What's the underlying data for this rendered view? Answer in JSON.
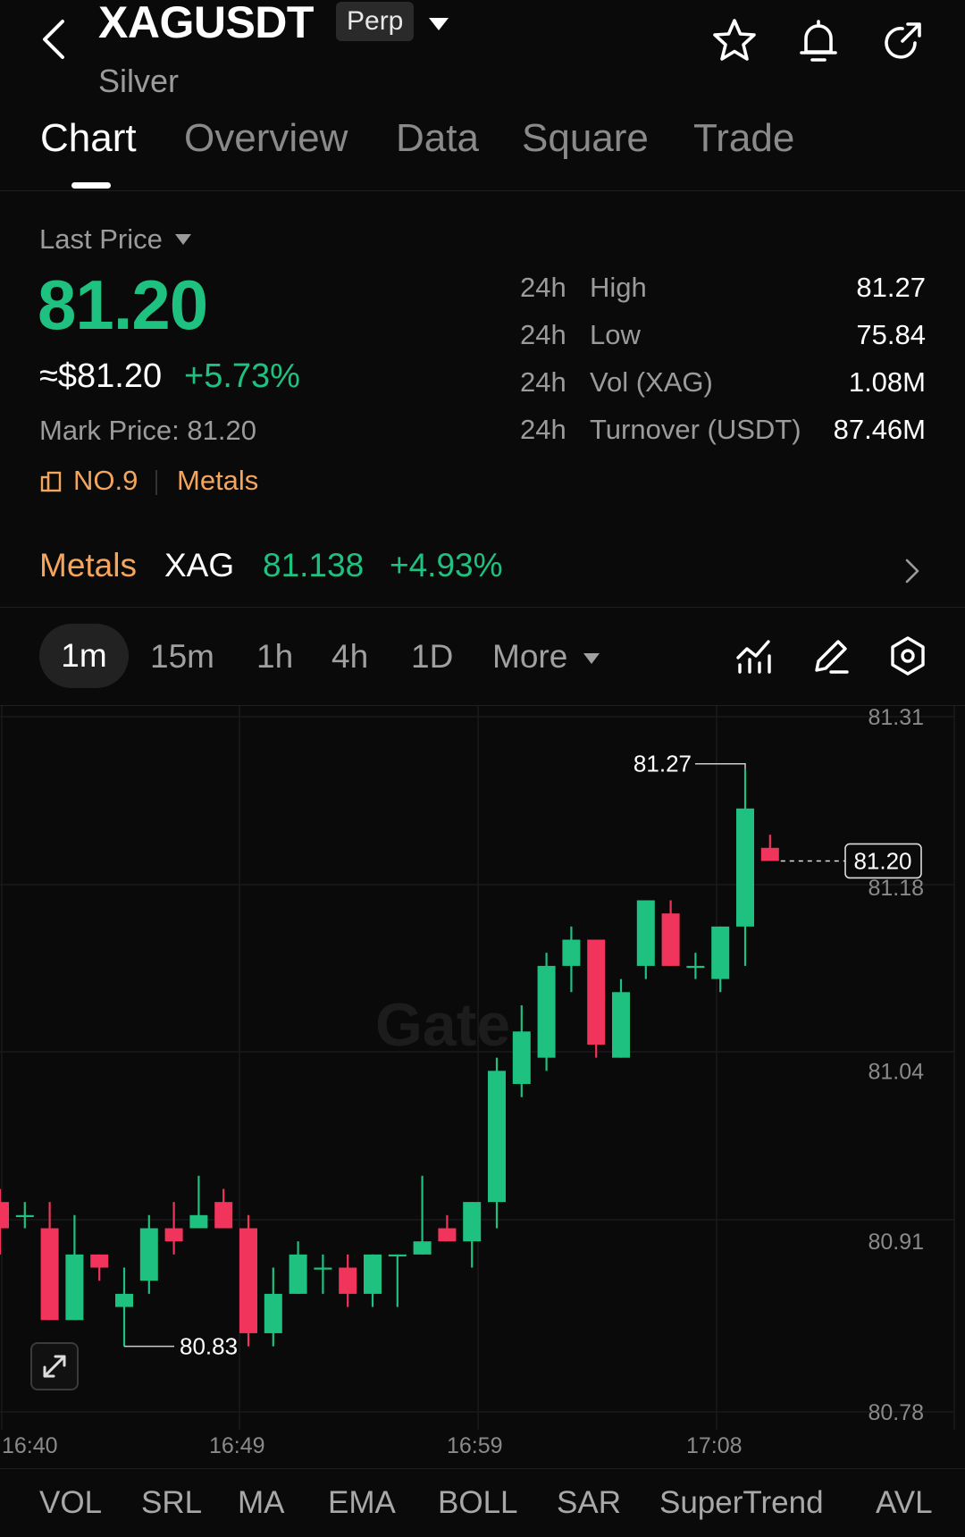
{
  "header": {
    "symbol": "XAGUSDT",
    "contract_type": "Perp",
    "name": "Silver",
    "icons": [
      "back-icon",
      "star-icon",
      "bell-icon",
      "share-icon"
    ]
  },
  "tabs": [
    {
      "label": "Chart",
      "active": true
    },
    {
      "label": "Overview",
      "active": false
    },
    {
      "label": "Data",
      "active": false
    },
    {
      "label": "Square",
      "active": false
    },
    {
      "label": "Trade",
      "active": false
    }
  ],
  "price": {
    "label": "Last Price",
    "last": "81.20",
    "usd": "≈$81.20",
    "change": "+5.73%",
    "mark": "Mark Price: 81.20",
    "rank": "NO.9",
    "category": "Metals"
  },
  "stats": [
    {
      "period": "24h",
      "name": "High",
      "value": "81.27"
    },
    {
      "period": "24h",
      "name": "Low",
      "value": "75.84"
    },
    {
      "period": "24h",
      "name": "Vol (XAG)",
      "value": "1.08M"
    },
    {
      "period": "24h",
      "name": "Turnover (USDT)",
      "value": "87.46M"
    }
  ],
  "index": {
    "category": "Metals",
    "symbol": "XAG",
    "price": "81.138",
    "change": "+4.93%"
  },
  "timeframes": [
    "1m",
    "15m",
    "1h",
    "4h",
    "1D",
    "More"
  ],
  "active_timeframe": "1m",
  "chart_labels": {
    "high_marker": "81.27",
    "low_marker": "80.83",
    "current_price": "81.20",
    "watermark": "Gate"
  },
  "chart_data": {
    "type": "candlestick",
    "interval": "1m",
    "y_ticks": [
      "81.31",
      "81.18",
      "81.04",
      "80.91",
      "80.78"
    ],
    "ylim": [
      80.78,
      81.31
    ],
    "x_ticks": [
      "16:40",
      "16:49",
      "16:59",
      "17:08"
    ],
    "candles": [
      {
        "o": 80.94,
        "c": 80.92,
        "h": 80.95,
        "l": 80.9
      },
      {
        "o": 80.93,
        "c": 80.93,
        "h": 80.94,
        "l": 80.92
      },
      {
        "o": 80.92,
        "c": 80.85,
        "h": 80.94,
        "l": 80.85
      },
      {
        "o": 80.85,
        "c": 80.9,
        "h": 80.93,
        "l": 80.85
      },
      {
        "o": 80.9,
        "c": 80.89,
        "h": 80.9,
        "l": 80.88
      },
      {
        "o": 80.86,
        "c": 80.87,
        "h": 80.89,
        "l": 80.83
      },
      {
        "o": 80.88,
        "c": 80.92,
        "h": 80.93,
        "l": 80.87
      },
      {
        "o": 80.92,
        "c": 80.91,
        "h": 80.94,
        "l": 80.9
      },
      {
        "o": 80.92,
        "c": 80.93,
        "h": 80.96,
        "l": 80.92
      },
      {
        "o": 80.94,
        "c": 80.92,
        "h": 80.95,
        "l": 80.92
      },
      {
        "o": 80.92,
        "c": 80.84,
        "h": 80.93,
        "l": 80.83
      },
      {
        "o": 80.84,
        "c": 80.87,
        "h": 80.89,
        "l": 80.83
      },
      {
        "o": 80.87,
        "c": 80.9,
        "h": 80.91,
        "l": 80.87
      },
      {
        "o": 80.89,
        "c": 80.89,
        "h": 80.9,
        "l": 80.87
      },
      {
        "o": 80.89,
        "c": 80.87,
        "h": 80.9,
        "l": 80.86
      },
      {
        "o": 80.87,
        "c": 80.9,
        "h": 80.9,
        "l": 80.86
      },
      {
        "o": 80.9,
        "c": 80.9,
        "h": 80.9,
        "l": 80.86
      },
      {
        "o": 80.9,
        "c": 80.91,
        "h": 80.96,
        "l": 80.9
      },
      {
        "o": 80.92,
        "c": 80.91,
        "h": 80.93,
        "l": 80.91
      },
      {
        "o": 80.91,
        "c": 80.94,
        "h": 80.94,
        "l": 80.89
      },
      {
        "o": 80.94,
        "c": 81.04,
        "h": 81.05,
        "l": 80.92
      },
      {
        "o": 81.03,
        "c": 81.07,
        "h": 81.09,
        "l": 81.02
      },
      {
        "o": 81.05,
        "c": 81.12,
        "h": 81.13,
        "l": 81.04
      },
      {
        "o": 81.12,
        "c": 81.14,
        "h": 81.15,
        "l": 81.1
      },
      {
        "o": 81.14,
        "c": 81.06,
        "h": 81.14,
        "l": 81.05
      },
      {
        "o": 81.05,
        "c": 81.1,
        "h": 81.11,
        "l": 81.05
      },
      {
        "o": 81.12,
        "c": 81.17,
        "h": 81.17,
        "l": 81.11
      },
      {
        "o": 81.16,
        "c": 81.12,
        "h": 81.17,
        "l": 81.12
      },
      {
        "o": 81.12,
        "c": 81.12,
        "h": 81.13,
        "l": 81.11
      },
      {
        "o": 81.11,
        "c": 81.15,
        "h": 81.15,
        "l": 81.1
      },
      {
        "o": 81.15,
        "c": 81.24,
        "h": 81.27,
        "l": 81.12
      },
      {
        "o": 81.21,
        "c": 81.2,
        "h": 81.22,
        "l": 81.2
      }
    ]
  },
  "indicators": [
    "VOL",
    "SRL",
    "MA",
    "EMA",
    "BOLL",
    "SAR",
    "SuperTrend",
    "AVL"
  ],
  "colors": {
    "up": "#1fc181",
    "down": "#f0345c",
    "accent": "#f5a55c",
    "background": "#0a0a0a"
  }
}
